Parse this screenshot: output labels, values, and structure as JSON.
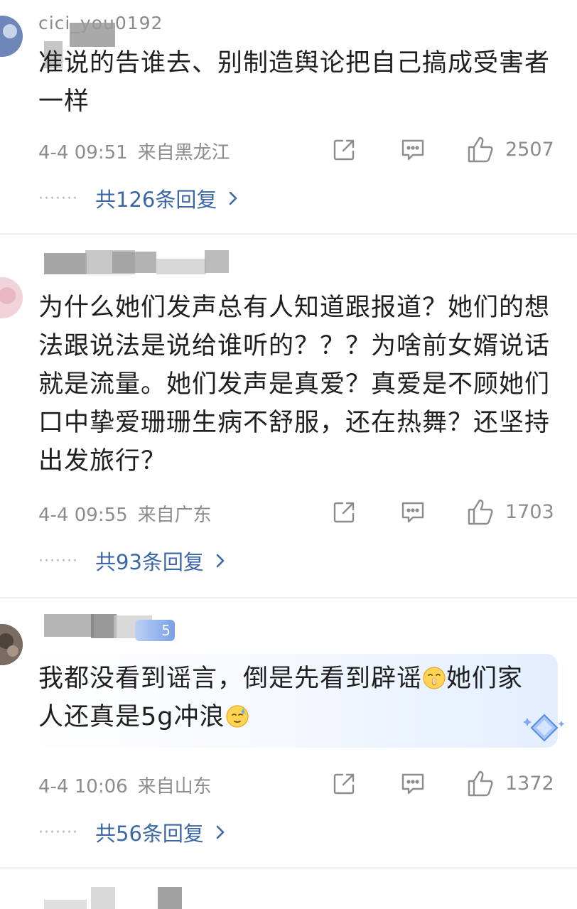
{
  "comments": [
    {
      "username": "cici_you0192",
      "text": "准说的告谁去、别制造舆论把自己搞成受害者一样",
      "time": "4-4 09:51",
      "region": "来自黑龙江",
      "likes": "2507",
      "replies": "共126条回复"
    },
    {
      "username": "",
      "text": "为什么她们发声总有人知道跟报道？她们的想法跟说法是说给谁听的？？？为啥前女婿说话就是流量。她们发声是真爱？真爱是不顾她们口中挚爱珊珊生病不舒服，还在热舞？还坚持出发旅行？",
      "time": "4-4 09:55",
      "region": "来自广东",
      "likes": "1703",
      "replies": "共93条回复"
    },
    {
      "username": "",
      "badge": "5",
      "text_part1": "我都没看到谣言，倒是先看到辟谣",
      "text_part2": "她们家人还真是5g冲浪",
      "time": "4-4 10:06",
      "region": "来自山东",
      "likes": "1372",
      "replies": "共56条回复"
    }
  ],
  "icons": {
    "share": "share-icon",
    "comment": "comment-icon",
    "like": "thumbs-up-icon",
    "chevron": "chevron-right-icon",
    "emoji1": "shushing-face-emoji",
    "emoji2": "sweat-face-emoji"
  },
  "colors": {
    "reply_link": "#3b67a6",
    "meta_gray": "#8c8c8c",
    "divider": "#ececec"
  }
}
